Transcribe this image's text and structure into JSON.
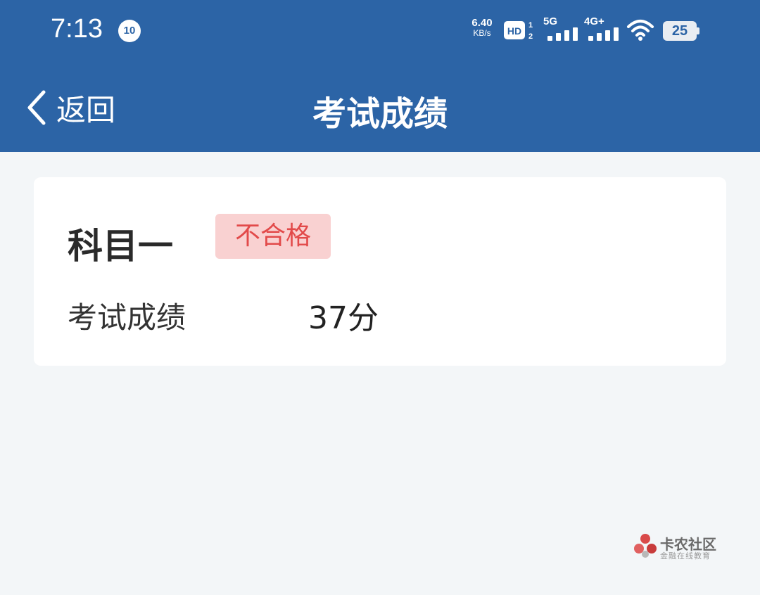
{
  "status_bar": {
    "time": "7:13",
    "notification_badge": "10",
    "net_speed_value": "6.40",
    "net_speed_unit": "KB/s",
    "signal_1_label": "5G",
    "signal_2_label": "4G+",
    "battery_level": "25",
    "icons": [
      "hd-voice-icon",
      "signal-icon",
      "wifi-icon",
      "battery-icon"
    ]
  },
  "nav": {
    "back_label": "返回",
    "title": "考试成绩",
    "background_color": "#2c64a6"
  },
  "result": {
    "subject": "科目一",
    "status_tag": "不合格",
    "status_color": "#e24a4a",
    "score_label": "考试成绩",
    "score_value": "37分"
  },
  "watermark": {
    "title": "卡农社区",
    "subtitle": "金融在线教育"
  }
}
